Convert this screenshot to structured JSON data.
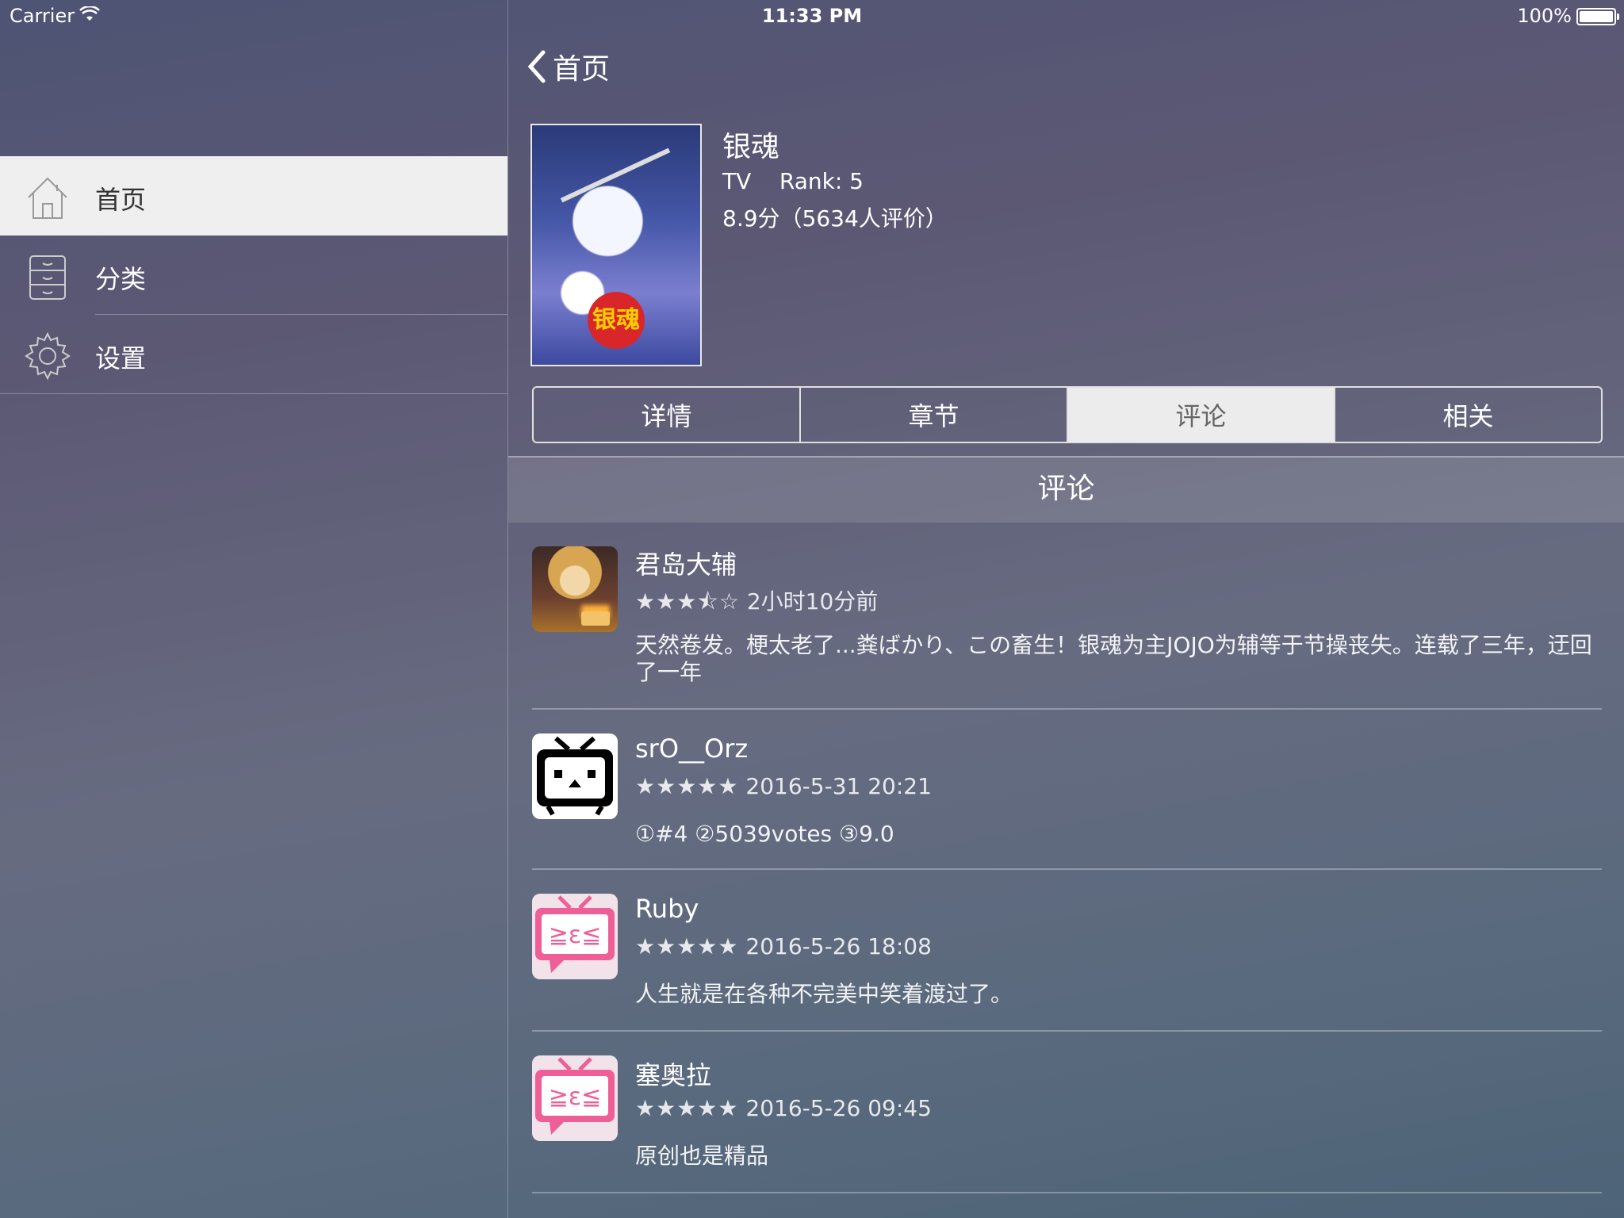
{
  "status_bar": {
    "carrier": "Carrier",
    "time": "11:33 PM",
    "battery": "100%"
  },
  "sidebar": {
    "items": [
      {
        "label": "首页",
        "icon": "home-icon",
        "active": true
      },
      {
        "label": "分类",
        "icon": "cabinet-icon",
        "active": false
      },
      {
        "label": "设置",
        "icon": "gear-icon",
        "active": false
      }
    ]
  },
  "nav": {
    "back_label": "首页"
  },
  "anime": {
    "title": "银魂",
    "type_rank": "TV    Rank: 5",
    "score": "8.9分（5634人评价）",
    "poster_logo": "银魂"
  },
  "tabs": [
    "详情",
    "章节",
    "评论",
    "相关"
  ],
  "active_tab": "评论",
  "section_title": "评论",
  "reviews": [
    {
      "name": "君岛大辅",
      "stars": "★★★⯪☆",
      "time": "2小时10分前",
      "text": "天然卷发。梗太老了...粪ばかり、この畜生！银魂为主JOJO为辅等于节操丧失。连载了三年，迂回了一年"
    },
    {
      "name": "srO__Orz",
      "stars": "★★★★★",
      "time": "2016-5-31 20:21",
      "text": "①#4 ②5039votes ③9.0"
    },
    {
      "name": "Ruby",
      "stars": "★★★★★",
      "time": "2016-5-26 18:08",
      "text": "人生就是在各种不完美中笑着渡过了。"
    },
    {
      "name": "塞奥拉",
      "stars": "★★★★★",
      "time": "2016-5-26 09:45",
      "text": "原创也是精品"
    }
  ],
  "colors": {
    "active_bg": "#efefef",
    "pink_avatar": "#ee5f97"
  }
}
